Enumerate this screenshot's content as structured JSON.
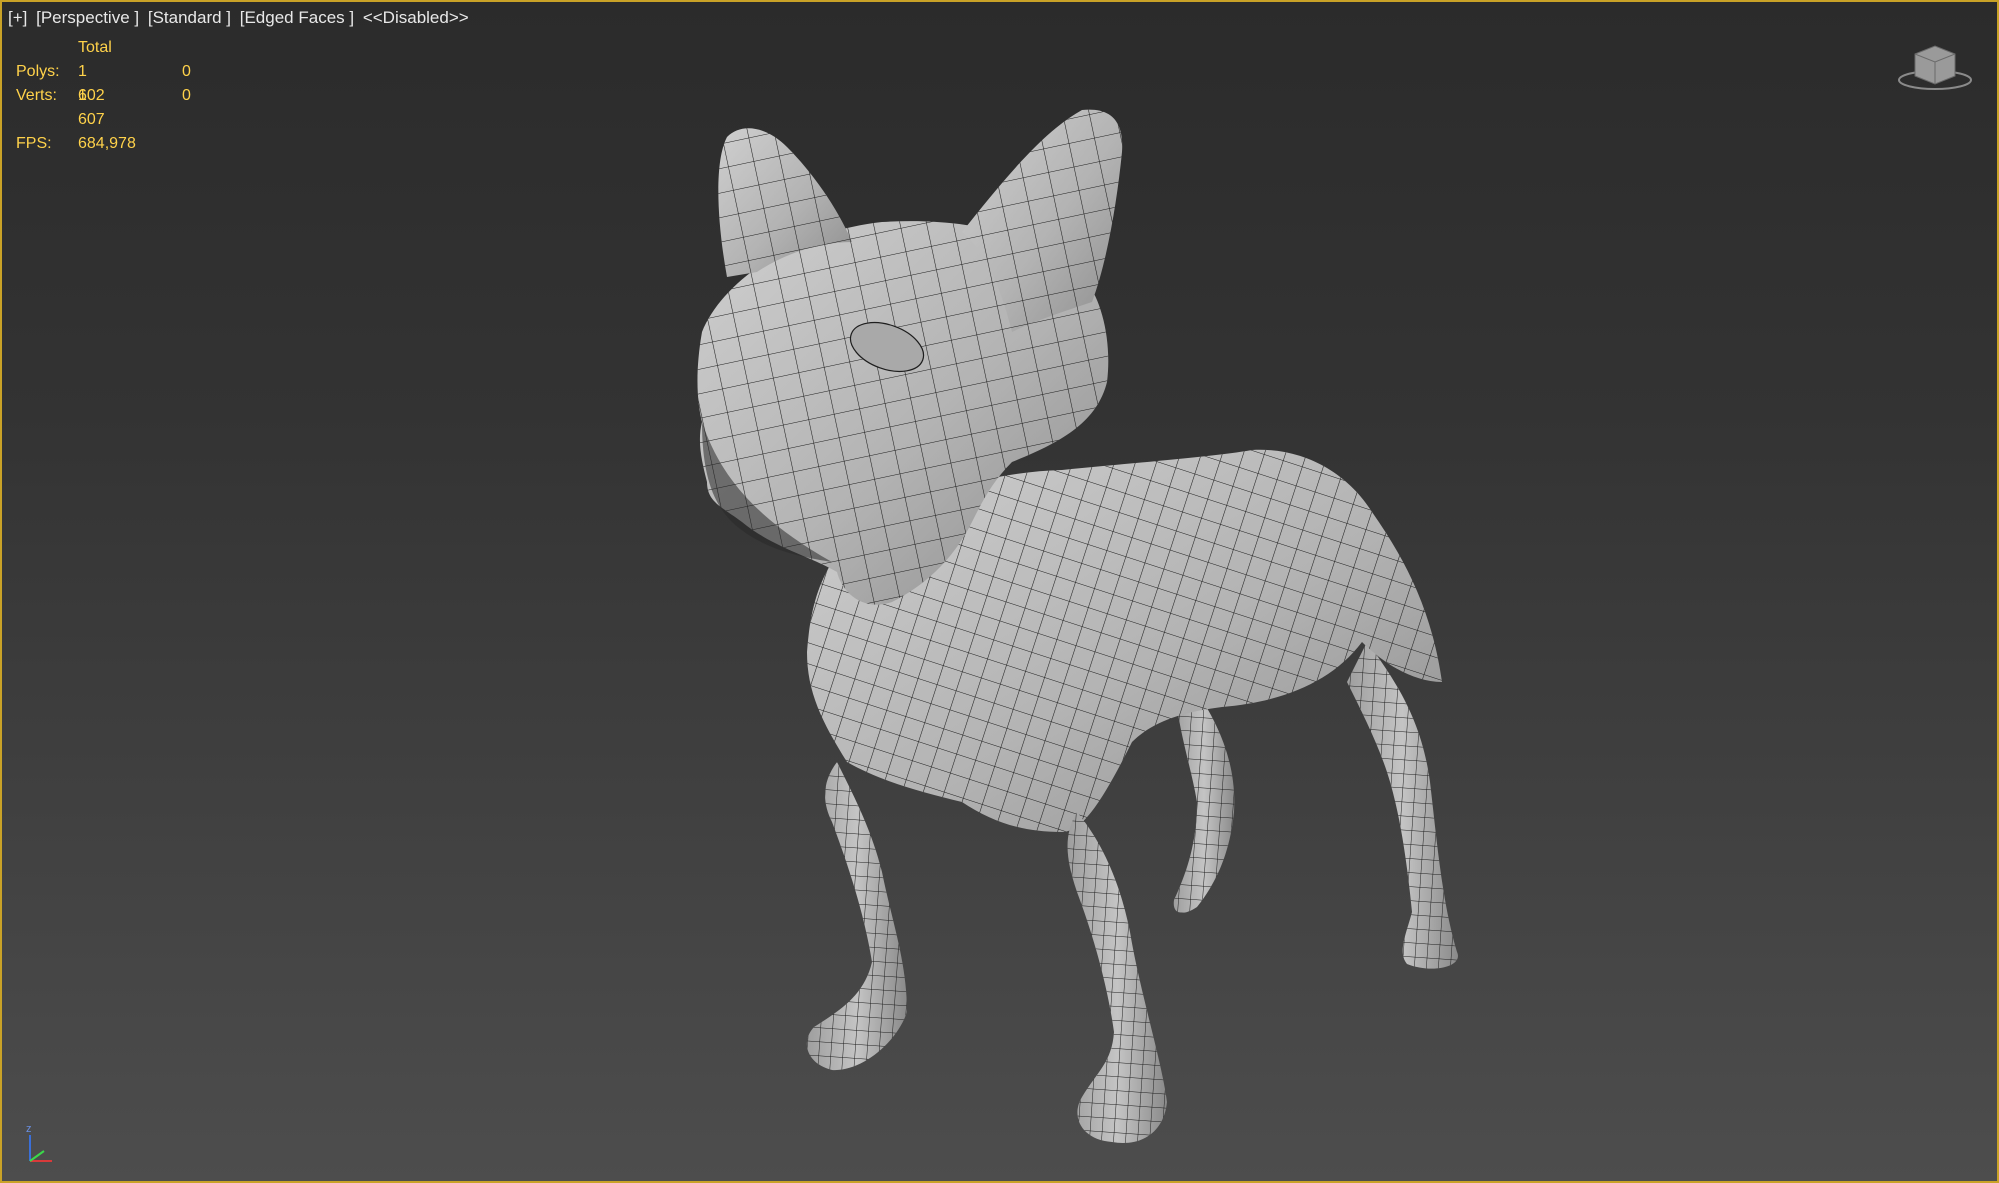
{
  "viewport": {
    "label": {
      "plus": "[+]",
      "view": "[Perspective ]",
      "shading": "[Standard ]",
      "display": "[Edged Faces ]",
      "status": "<<Disabled>>"
    },
    "stats": {
      "header": "Total",
      "polys_label": "Polys:",
      "polys_total": "1 602",
      "polys_selected": "0",
      "verts_label": "Verts:",
      "verts_total": "1 607",
      "verts_selected": "0",
      "fps_label": "FPS:",
      "fps_value": "684,978"
    },
    "viewcube_icon": "viewcube-icon",
    "axis_icon": "axis-tripod-icon",
    "axis_z_label": "z",
    "colors": {
      "border": "#c9a227",
      "stats_text": "#ffd24a",
      "label_text": "#e8e8e8",
      "mesh_fill": "#b9b9b9",
      "wire": "#1e1e1e"
    }
  }
}
